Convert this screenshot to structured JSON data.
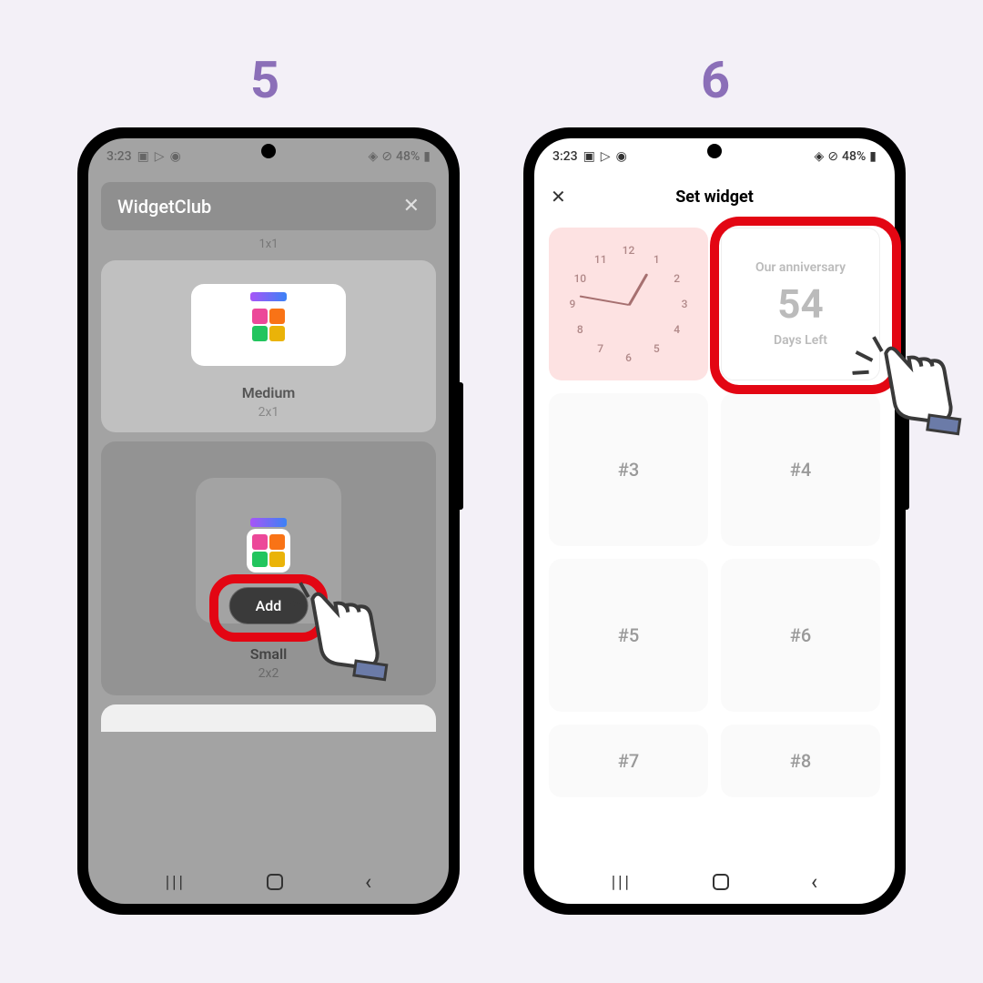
{
  "steps": {
    "five": "5",
    "six": "6"
  },
  "status": {
    "time": "3:23",
    "battery": "48%"
  },
  "phone5": {
    "app_name": "WidgetClub",
    "top_size": "1x1",
    "medium": {
      "name": "Medium",
      "size": "2x1"
    },
    "small": {
      "name": "Small",
      "size": "2x2",
      "add_label": "Add"
    }
  },
  "phone6": {
    "title": "Set widget",
    "countdown": {
      "title": "Our anniversary",
      "days": "54",
      "subtitle": "Days Left"
    },
    "slots": [
      "#3",
      "#4",
      "#5",
      "#6",
      "#7",
      "#8"
    ]
  },
  "nav": {
    "recent": "|||",
    "home": "▢",
    "back": "‹"
  }
}
